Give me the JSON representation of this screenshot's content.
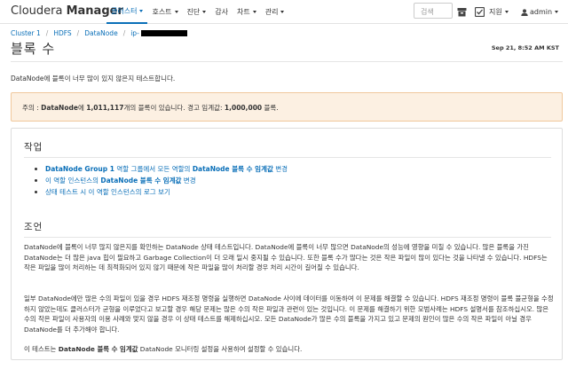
{
  "brand": {
    "part1": "Cloudera",
    "part2": "Manager"
  },
  "nav": {
    "items": [
      {
        "label": "클러스터",
        "active": true
      },
      {
        "label": "호스트",
        "active": false
      },
      {
        "label": "진단",
        "active": false
      },
      {
        "label": "감사",
        "active": false
      },
      {
        "label": "차트",
        "active": false
      },
      {
        "label": "관리",
        "active": false
      }
    ],
    "search_placeholder": "검색",
    "support_label": "지원",
    "user_label": "admin"
  },
  "breadcrumb": [
    "Cluster 1",
    "HDFS",
    "DataNode",
    "ip-"
  ],
  "page_title": "블록 수",
  "timestamp": "Sep 21, 8:52 AM KST",
  "intro": "DataNode에 블록이 너무 많이 있지 않은지 테스트합니다.",
  "alert": {
    "prefix": "주의 : ",
    "bold1": "DataNode",
    "mid1": "에 ",
    "bold2": "1,011,117",
    "mid2": "개의 블록이 있습니다. 경고 임계값: ",
    "bold3": "1,000,000",
    "suffix": " 블록."
  },
  "actions": {
    "title": "작업",
    "items": [
      {
        "b1": "DataNode Group 1",
        "t1": " 역할 그룹에서 모든 역할의 ",
        "b2": "DataNode 블록 수 임계값",
        "t2": " 변경"
      },
      {
        "b1": "",
        "t1": "이 역할 인스턴스의 ",
        "b2": "DataNode 블록 수 임계값",
        "t2": " 변경"
      },
      {
        "b1": "",
        "t1": "상태 테스트 시 이 역할 인스턴스의 로그 보기",
        "b2": "",
        "t2": ""
      }
    ]
  },
  "advice": {
    "title": "조언",
    "para1": "DataNode에 블록이 너무 많지 않은지를 확인하는 DataNode 상태 테스트입니다. DataNode에 블록이 너무 많으면 DataNode의 성능에 영향을 미칠 수 있습니다. 많은 블록을 가진 DataNode는 더 많은 java 힙이 필요하고 Garbage Collection이 더 오래 일시 중지될 수 있습니다. 또한 블록 수가 많다는 것은 작은 파일이 많이 있다는 것을 나타낼 수 있습니다. HDFS는 작은 파일을 많이 처리하는 데 최적화되어 있지 않기 때문에 작은 파일을 많이 처리할 경우 처리 시간이 길어질 수 있습니다.",
    "para2": "일부 DataNode에만 많은 수의 파일이 있을 경우 HDFS 재조정 명령을 실행하면 DataNode 사이에 데이터를 이동하여 이 문제를 해결할 수 있습니다. HDFS 재조정 명령이 블록 불균형을 수정하지 않았는데도 클러스터가 균형을 이루었다고 보고할 경우 해당 문제는 많은 수의 작은 파일과 관련이 있는 것입니다. 이 문제를 해결하기 위한 모범사례는 HDFS 설명서를 참조하십시오. 많은 수의 작은 파일이 사용자의 이용 사례와 맞지 않을 경우 이 상태 테스트를 해제하십시오. 모든 DataNode가 많은 수의 블록을 가지고 있고 문제의 원인이 많은 수의 작은 파일이 아닐 경우 DataNode를 더 추가해야 합니다.",
    "p3_prefix": "이 테스트는 ",
    "p3_bold": "DataNode 블록 수 임계값",
    "p3_suffix": " DataNode 모니터링 설정을 사용하여 설정할 수 있습니다."
  },
  "colors": {
    "link": "#0a6fb8",
    "alert_bg": "#fcf0e2",
    "alert_border": "#f0c89c"
  }
}
